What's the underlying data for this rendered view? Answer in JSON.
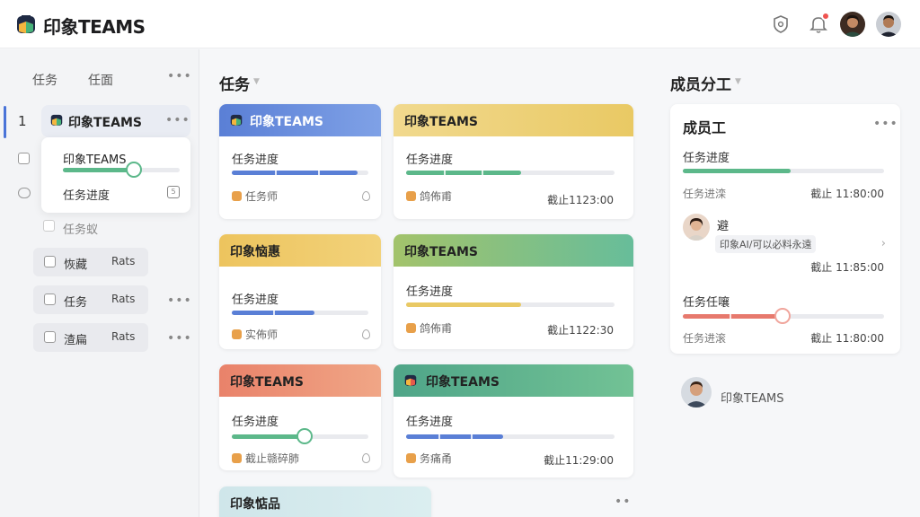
{
  "app": {
    "title": "印象TEAMS"
  },
  "colors": {
    "accent_blue": "#5a7fd6",
    "green": "#5cb88a",
    "yellow": "#e9c964",
    "orange": "#ec8a6c",
    "red": "#e7796d"
  },
  "topbar": {
    "icons": [
      "shield-icon",
      "bell-icon"
    ],
    "notification_badge": ""
  },
  "sidebar": {
    "tabs": [
      "任务",
      "任面"
    ],
    "active_index": "1",
    "active_title": "印象TEAMS",
    "popover": {
      "title": "印象TEAMS",
      "progress_label": "任务进度",
      "progress": 0.65,
      "cal": "5"
    },
    "sub_label": "任务蚁",
    "items": [
      {
        "label": "恢藏",
        "right": "Rats"
      },
      {
        "label": "任务",
        "right": "Rats"
      },
      {
        "label": "渣扁",
        "right": "Rats"
      }
    ]
  },
  "tasks": {
    "title": "任务",
    "cards": [
      {
        "title": "印象TEAMS",
        "progress_label": "任务进度",
        "progress": 0.95,
        "meta": "任务师",
        "right": "",
        "icon": "pin-icon"
      },
      {
        "title": "印象TEAMS",
        "progress_label": "任务进度",
        "progress": 0.55,
        "meta": "鸽佈甫",
        "right": "截止1123:00",
        "icon": ""
      },
      {
        "title": "印象恼惠",
        "progress_label": "任务进度",
        "progress": 0.6,
        "meta": "实佈师",
        "right": "",
        "icon": "pin-icon"
      },
      {
        "title": "印象TEAMS",
        "progress_label": "任务进度",
        "progress": 0.55,
        "meta": "鸽佈甫",
        "right": "截止1122:30",
        "icon": ""
      },
      {
        "title": "印象TEAMS",
        "progress_label": "任务进度",
        "progress": 0.5,
        "meta": "截止赣碎肺",
        "right": "",
        "icon": "pin-icon"
      },
      {
        "title": "印象TEAMS",
        "progress_label": "任务进度",
        "progress": 0.45,
        "meta": "务痛甬",
        "right": "截止11:29:00",
        "icon": ""
      }
    ],
    "bottom_card_title": "印象惦品"
  },
  "members": {
    "title": "成员分工",
    "card": {
      "title": "成员工",
      "progress1_label": "任务进度",
      "progress1": 0.5,
      "sub1": "任务进滦",
      "sub1_right": "截止 11:80:00",
      "person_name": "避",
      "person_tag": "印象AI/可以必料永遠",
      "person_right": "截止 11:85:00",
      "progress2_label": "任务任嚷",
      "progress2": 0.45,
      "sub2": "任务进滚",
      "sub2_right": "截止 11:80:00"
    },
    "member2_name": "印象TEAMS"
  }
}
